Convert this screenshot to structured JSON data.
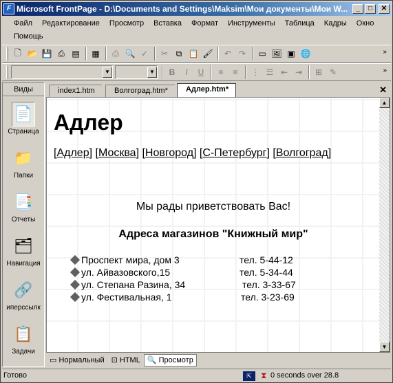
{
  "window": {
    "title": "Microsoft FrontPage - D:\\Documents and Settings\\Maksim\\Мои документы\\Мои W..."
  },
  "menu": [
    "Файл",
    "Редактирование",
    "Просмотр",
    "Вставка",
    "Формат",
    "Инструменты",
    "Таблица",
    "Кадры",
    "Окно",
    "Помощь"
  ],
  "views": {
    "header": "Виды",
    "items": [
      {
        "label": "Страница",
        "icon": "page-view-icon",
        "selected": true
      },
      {
        "label": "Папки",
        "icon": "folder-icon",
        "selected": false
      },
      {
        "label": "Отчеты",
        "icon": "reports-icon",
        "selected": false
      },
      {
        "label": "Навигация",
        "icon": "navigation-icon",
        "selected": false
      },
      {
        "label": "иперссылк",
        "icon": "hyperlinks-icon",
        "selected": false
      },
      {
        "label": "Задачи",
        "icon": "tasks-icon",
        "selected": false
      }
    ]
  },
  "tabs": [
    {
      "label": "index1.htm",
      "active": false
    },
    {
      "label": "Волгоград.htm*",
      "active": false
    },
    {
      "label": "Адлер.htm*",
      "active": true
    }
  ],
  "page": {
    "heading": "Адлер",
    "nav": [
      "Адлер",
      "Москва",
      "Новгород",
      "С-Петербург",
      "Волгоград"
    ],
    "welcome": "Мы рады приветствовать Вас!",
    "stores_title": "Адреса магазинов \"Книжный мир\"",
    "addresses": [
      {
        "street": "Проспект мира, дом 3",
        "phone": "тел. 5-44-12"
      },
      {
        "street": "ул. Айвазовского,15",
        "phone": "тел. 5-34-44"
      },
      {
        "street": "ул. Степана Разина, 34",
        "phone": "тел. 3-33-67"
      },
      {
        "street": "ул. Фестивальная, 1",
        "phone": "тел. 3-23-69"
      }
    ]
  },
  "view_tabs": [
    {
      "label": "Нормальный",
      "active": false
    },
    {
      "label": "HTML",
      "active": false
    },
    {
      "label": "Просмотр",
      "active": true
    }
  ],
  "status": {
    "text": "Готово",
    "timing": "0 seconds over 28.8"
  }
}
